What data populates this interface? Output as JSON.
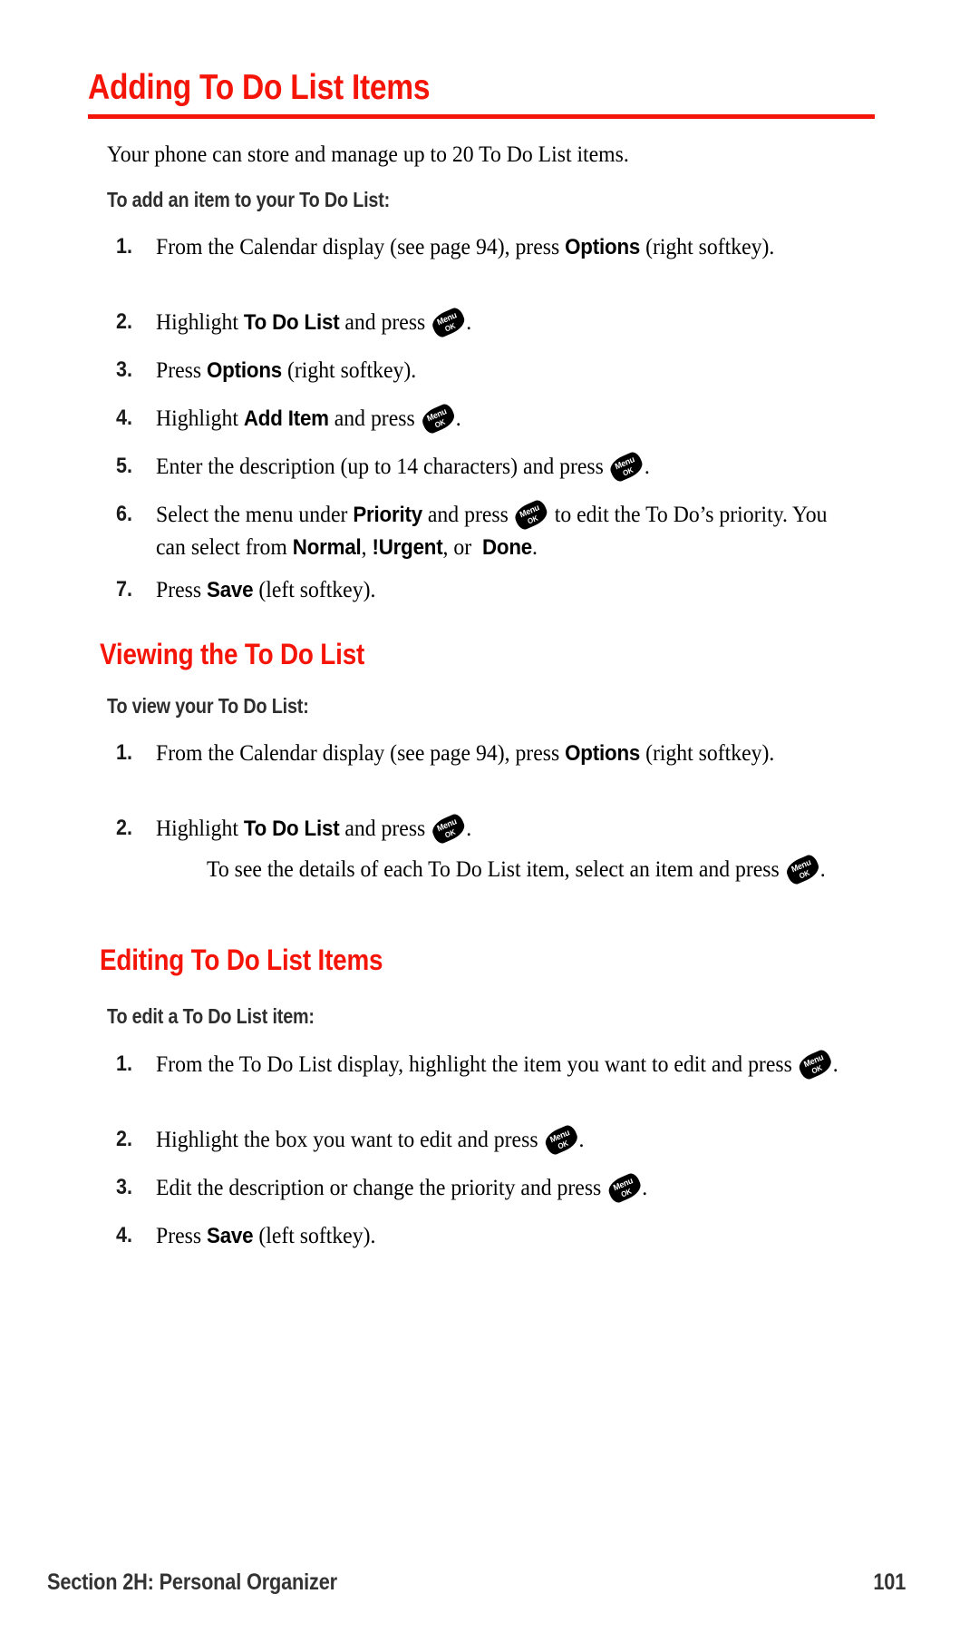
{
  "page": {
    "number": "101",
    "accent_color": "#f51408",
    "text_color": "#000000",
    "heading_gray": "#2e2e2e"
  },
  "title": {
    "text": "Adding To Do List Items"
  },
  "intro": {
    "text": "Your phone can store and manage up to 20 To Do List items."
  },
  "sections": [
    {
      "sub_heading": "To add an item to your To Do List:",
      "steps": [
        {
          "num": "1.",
          "pre": "From the Calendar display (see page 94), press ",
          "bold": "Options",
          "post": " (right softkey).",
          "icon": false
        },
        {
          "num": "2.",
          "pre": "Highlight ",
          "bold": "To Do List",
          "post": " and press ",
          "icon": true,
          "tail": "."
        },
        {
          "num": "3.",
          "pre": "Press ",
          "bold": "Options",
          "post": " (right softkey).",
          "icon": false
        },
        {
          "num": "4.",
          "pre": "Highlight ",
          "bold": "Add Item",
          "post": " and press ",
          "icon": true,
          "tail": "."
        },
        {
          "num": "5.",
          "pre": "Enter the description (up to 14 characters) and press ",
          "bold": "",
          "post": "",
          "icon": true,
          "tail": "."
        },
        {
          "num": "6.",
          "pre": "Select the menu under ",
          "bold": "Priority",
          "post": " and press ",
          "icon": true,
          "tail": " to edit the To Do’s priority. You can select from ",
          "bold2": "Normal",
          "mid2": ", ",
          "bold3": "!Urgent",
          "mid3": ", or ",
          "bold4": "Done",
          "tail2": "."
        },
        {
          "num": "7.",
          "pre": "Press ",
          "bold": "Save",
          "post": " (left softkey).",
          "icon": false
        }
      ]
    },
    {
      "heading": "Viewing the To Do List",
      "sub_heading": "To view your To Do List:",
      "steps": [
        {
          "num": "1.",
          "pre": "From the Calendar display (see page 94), press ",
          "bold": "Options",
          "post": " (right softkey).",
          "icon": false
        },
        {
          "num": "2.",
          "pre": "Highlight ",
          "bold": "To Do List",
          "post": " and press ",
          "icon": true,
          "tail": "."
        }
      ],
      "note": {
        "pre": "To see the details of each To Do List item, select an item and press ",
        "tail": "."
      }
    },
    {
      "heading": "Editing To Do List Items",
      "sub_heading": "To edit a To Do List item:",
      "steps": [
        {
          "num": "1.",
          "pre": "From the To Do List display, highlight the item you want to edit and press ",
          "bold": "",
          "post": "",
          "icon": true,
          "tail": "."
        },
        {
          "num": "2.",
          "pre": "Highlight the box you want to edit and press ",
          "bold": "",
          "post": "",
          "icon": true,
          "tail": "."
        },
        {
          "num": "3.",
          "pre": "Edit the description or change the priority and press ",
          "bold": "",
          "post": "",
          "icon": true,
          "tail": "."
        },
        {
          "num": "4.",
          "pre": "Press ",
          "bold": "Save",
          "post": " (left softkey).",
          "icon": false
        }
      ]
    }
  ],
  "menu_key": {
    "line1": "Menu",
    "line2": "OK"
  },
  "footer": {
    "left": "Section 2H: Personal Organizer",
    "right": "101"
  }
}
